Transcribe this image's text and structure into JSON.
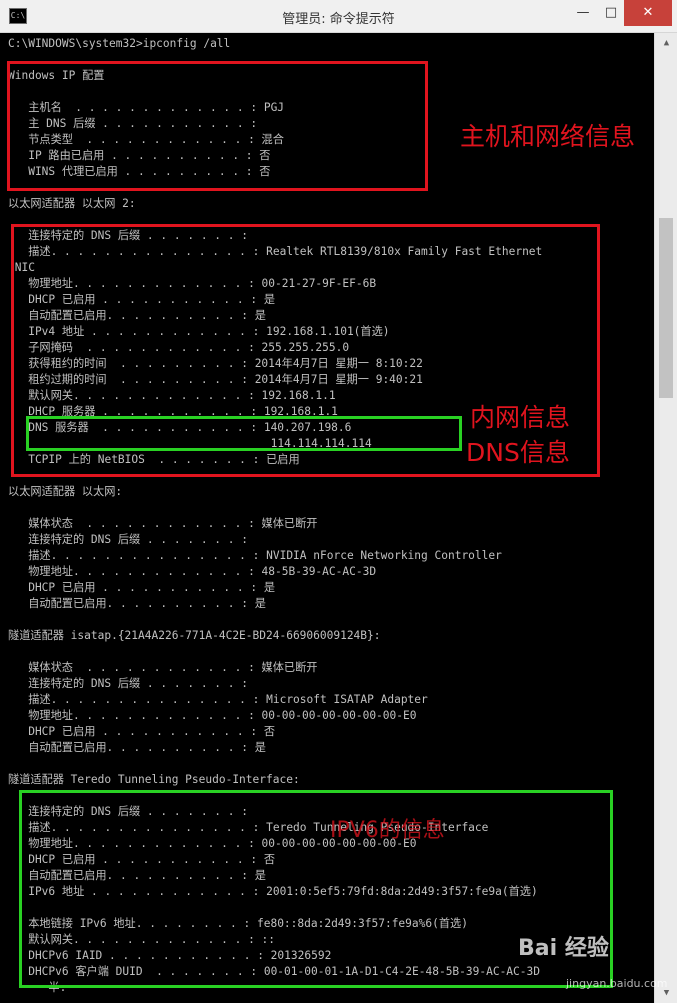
{
  "window": {
    "icon": "C:\\",
    "title": "管理员: 命令提示符",
    "minimize": "—",
    "maximize": "□",
    "close": "✕"
  },
  "console": {
    "lines": [
      "C:\\WINDOWS\\system32>ipconfig /all",
      "",
      "Windows IP 配置",
      "",
      "   主机名  . . . . . . . . . . . . . : PGJ",
      "   主 DNS 后缀 . . . . . . . . . . . :",
      "   节点类型  . . . . . . . . . . . . : 混合",
      "   IP 路由已启用 . . . . . . . . . . : 否",
      "   WINS 代理已启用 . . . . . . . . . : 否",
      "",
      "以太网适配器 以太网 2:",
      "",
      "   连接特定的 DNS 后缀 . . . . . . . :",
      "   描述. . . . . . . . . . . . . . . : Realtek RTL8139/810x Family Fast Ethernet",
      " NIC",
      "   物理地址. . . . . . . . . . . . . : 00-21-27-9F-EF-6B",
      "   DHCP 已启用 . . . . . . . . . . . : 是",
      "   自动配置已启用. . . . . . . . . . : 是",
      "   IPv4 地址 . . . . . . . . . . . . : 192.168.1.101(首选)",
      "   子网掩码  . . . . . . . . . . . . : 255.255.255.0",
      "   获得租约的时间  . . . . . . . . . : 2014年4月7日 星期一 8:10:22",
      "   租约过期的时间  . . . . . . . . . : 2014年4月7日 星期一 9:40:21",
      "   默认网关. . . . . . . . . . . . . : 192.168.1.1",
      "   DHCP 服务器 . . . . . . . . . . . : 192.168.1.1",
      "   DNS 服务器  . . . . . . . . . . . : 140.207.198.6",
      "                                       114.114.114.114",
      "   TCPIP 上的 NetBIOS  . . . . . . . : 已启用",
      "",
      "以太网适配器 以太网:",
      "",
      "   媒体状态  . . . . . . . . . . . . : 媒体已断开",
      "   连接特定的 DNS 后缀 . . . . . . . :",
      "   描述. . . . . . . . . . . . . . . : NVIDIA nForce Networking Controller",
      "   物理地址. . . . . . . . . . . . . : 48-5B-39-AC-AC-3D",
      "   DHCP 已启用 . . . . . . . . . . . : 是",
      "   自动配置已启用. . . . . . . . . . : 是",
      "",
      "隧道适配器 isatap.{21A4A226-771A-4C2E-BD24-66906009124B}:",
      "",
      "   媒体状态  . . . . . . . . . . . . : 媒体已断开",
      "   连接特定的 DNS 后缀 . . . . . . . :",
      "   描述. . . . . . . . . . . . . . . : Microsoft ISATAP Adapter",
      "   物理地址. . . . . . . . . . . . . : 00-00-00-00-00-00-00-E0",
      "   DHCP 已启用 . . . . . . . . . . . : 否",
      "   自动配置已启用. . . . . . . . . . : 是",
      "",
      "隧道适配器 Teredo Tunneling Pseudo-Interface:",
      "",
      "   连接特定的 DNS 后缀 . . . . . . . :",
      "   描述. . . . . . . . . . . . . . . : Teredo Tunneling Pseudo-Interface",
      "   物理地址. . . . . . . . . . . . . : 00-00-00-00-00-00-00-E0",
      "   DHCP 已启用 . . . . . . . . . . . : 否",
      "   自动配置已启用. . . . . . . . . . : 是",
      "   IPv6 地址 . . . . . . . . . . . . : 2001:0:5ef5:79fd:8da:2d49:3f57:fe9a(首选)",
      "",
      "   本地链接 IPv6 地址. . . . . . . . : fe80::8da:2d49:3f57:fe9a%6(首选)",
      "   默认网关. . . . . . . . . . . . . : ::",
      "   DHCPv6 IAID . . . . . . . . . . . : 201326592",
      "   DHCPv6 客户端 DUID  . . . . . . . : 00-01-00-01-1A-D1-C4-2E-48-5B-39-AC-AC-3D",
      "      半:"
    ]
  },
  "annotations": {
    "host_network": "主机和网络信息",
    "lan_info": "内网信息",
    "dns_info": "DNS信息",
    "ipv6_info": "IPV6的信息"
  },
  "watermark": {
    "logo": "Bai 经验",
    "url": "jingyan.baidu.com"
  },
  "scrollbar": {
    "up_arrow": "▲",
    "down_arrow": "▼",
    "position": 0.22
  },
  "colors": {
    "console_bg": "#000000",
    "console_text": "#c0c0c0",
    "highlight_red": "#e0141e",
    "highlight_green": "#29d123",
    "close_button": "#c7413a"
  }
}
